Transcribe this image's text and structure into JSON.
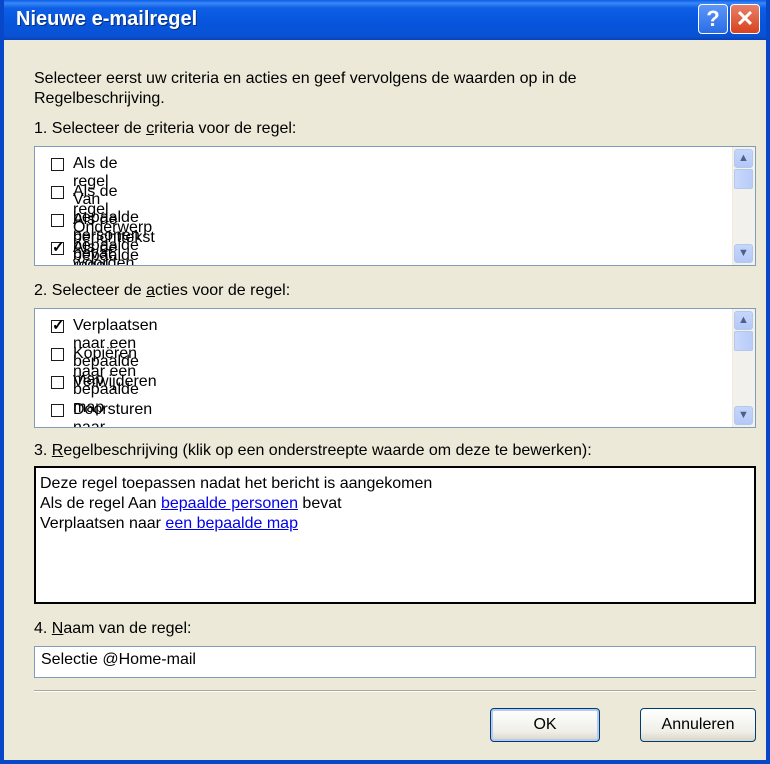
{
  "window": {
    "title": "Nieuwe e-mailregel",
    "help_label": "?",
    "close_label": "✕"
  },
  "intro": {
    "line1": "Selecteer eerst uw criteria en acties en geef vervolgens de waarden op in de",
    "line2": "Regelbeschrijving."
  },
  "section1": {
    "label_prefix": "1. Selecteer de ",
    "label_accel": "c",
    "label_suffix": "riteria voor de regel:",
    "items": [
      {
        "label": "Als de regel Van bepaalde personen bevat",
        "checked": false
      },
      {
        "label": "Als de regel Onderwerp bepaalde woorden bevat",
        "checked": false
      },
      {
        "label": "Als de berichttekst bepaalde woorden bevat",
        "checked": false
      },
      {
        "label": "Als de regel Aan bepaalde personen bevat",
        "checked": true
      }
    ]
  },
  "section2": {
    "label_prefix": "2. Selecteer de ",
    "label_accel": "a",
    "label_suffix": "cties voor de regel:",
    "items": [
      {
        "label": "Verplaatsen naar een bepaalde map",
        "checked": true
      },
      {
        "label": "Kopiëren naar een bepaalde map",
        "checked": false
      },
      {
        "label": "Verwijderen",
        "checked": false
      },
      {
        "label": "Doorsturen naar bepaalde personen",
        "checked": false
      }
    ]
  },
  "section3": {
    "label_prefix": "3. ",
    "label_accel": "R",
    "label_suffix": "egelbeschrijving (klik op een onderstreepte waarde om deze te bewerken):",
    "line1": "Deze regel toepassen nadat het bericht is aangekomen",
    "line2_prefix": "Als de regel Aan ",
    "line2_link": "bepaalde personen",
    "line2_suffix": " bevat",
    "line3_prefix": "Verplaatsen naar ",
    "line3_link": "een bepaalde map"
  },
  "section4": {
    "label_prefix": "4. ",
    "label_accel": "N",
    "label_suffix": "aam van de regel:",
    "value": "Selectie @Home-mail"
  },
  "buttons": {
    "ok": "OK",
    "cancel": "Annuleren"
  }
}
